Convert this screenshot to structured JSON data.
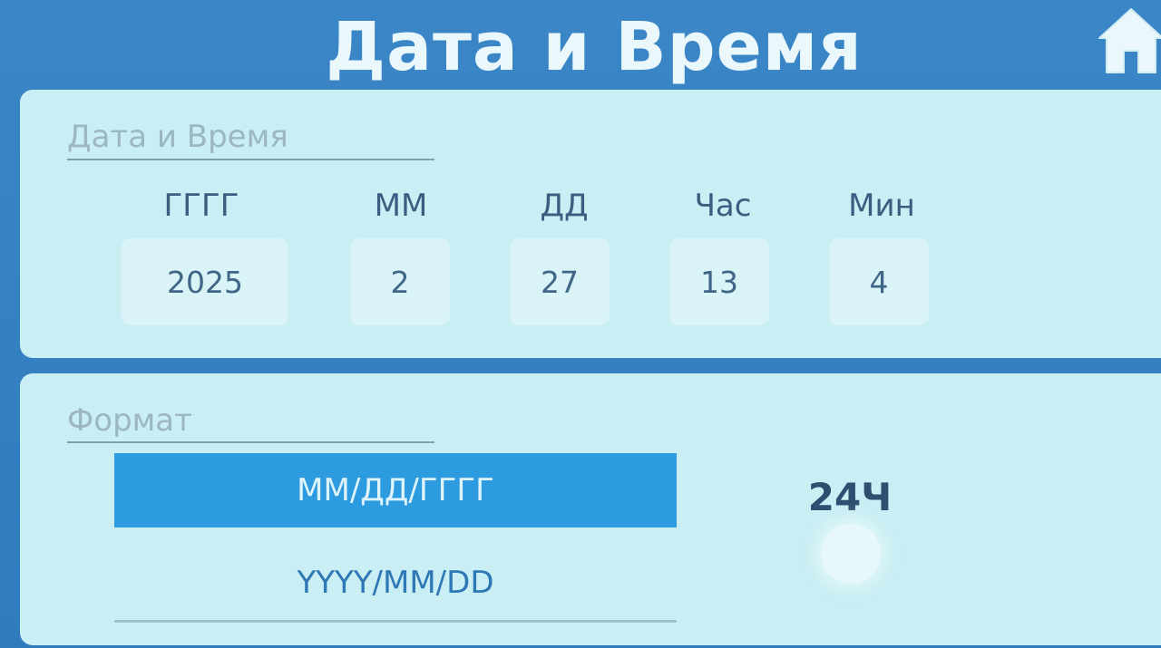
{
  "header": {
    "title": "Дата и Время"
  },
  "date_time": {
    "section_title": "Дата и Время",
    "fields": [
      {
        "label": "ГГГГ",
        "value": "2025"
      },
      {
        "label": "ММ",
        "value": "2"
      },
      {
        "label": "ДД",
        "value": "27"
      },
      {
        "label": "Час",
        "value": "13"
      },
      {
        "label": "Мин",
        "value": "4"
      }
    ]
  },
  "format": {
    "section_title": "Формат",
    "options": [
      {
        "label": "ММ/ДД/ГГГГ",
        "selected": true
      },
      {
        "label": "YYYY/MM/DD",
        "selected": false
      }
    ],
    "clock_label": "24Ч"
  },
  "colors": {
    "background": "#2f7fc1",
    "card": "#c9eef3",
    "selected_option": "#2d9be0"
  },
  "icons": {
    "home": "home-icon"
  }
}
